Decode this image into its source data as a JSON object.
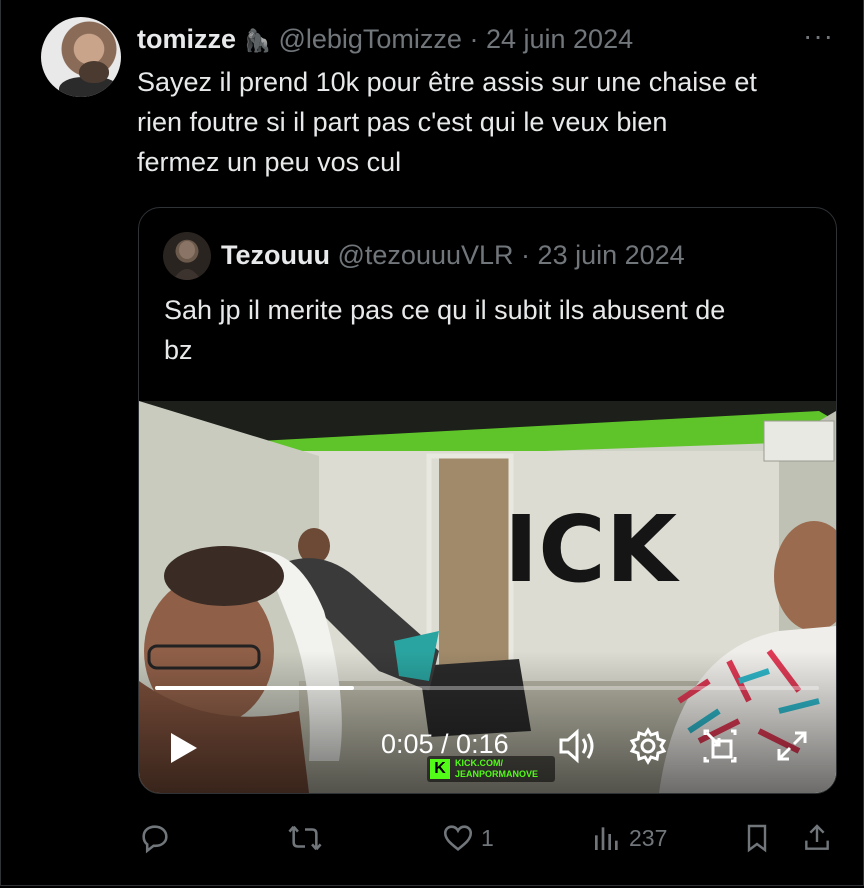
{
  "tweet": {
    "display_name": "tomizze",
    "name_emoji": "🦍",
    "handle": "@lebigTomizze",
    "separator": "·",
    "date": "24 juin 2024",
    "more_label": "···",
    "text_lines": [
      "Sayez il prend 10k pour être assis sur une chaise et",
      "rien foutre si il part pas c'est qui le veux bien",
      "fermez un peu vos cul"
    ]
  },
  "quote": {
    "display_name": "Tezouuu",
    "handle": "@tezouuuVLR",
    "separator": "·",
    "date": "23 juin 2024",
    "text_lines": [
      "Sah jp il merite pas ce qu il subit ils abusent de",
      "bz"
    ],
    "video": {
      "current_time": "0:05",
      "duration": "0:16",
      "time_display": "0:05 / 0:16",
      "progress_fraction": 0.3,
      "watermark_letter": "K",
      "watermark_line1": "KICK.COM/",
      "watermark_line2": "JEANPORMANOVE",
      "wall_text": "ICK",
      "controls": [
        "play-icon",
        "volume-icon",
        "settings-icon",
        "picture-in-picture-icon",
        "fullscreen-icon"
      ]
    }
  },
  "actions": {
    "reply_count": "",
    "retweet_count": "",
    "like_count": "1",
    "views_count": "237",
    "icons": [
      "reply-icon",
      "retweet-icon",
      "like-icon",
      "views-icon",
      "bookmark-icon",
      "share-icon"
    ]
  },
  "colors": {
    "background": "#000000",
    "text": "#e7e9ea",
    "muted": "#71767b",
    "border": "#2f3336",
    "kick_green": "#53fc18"
  }
}
